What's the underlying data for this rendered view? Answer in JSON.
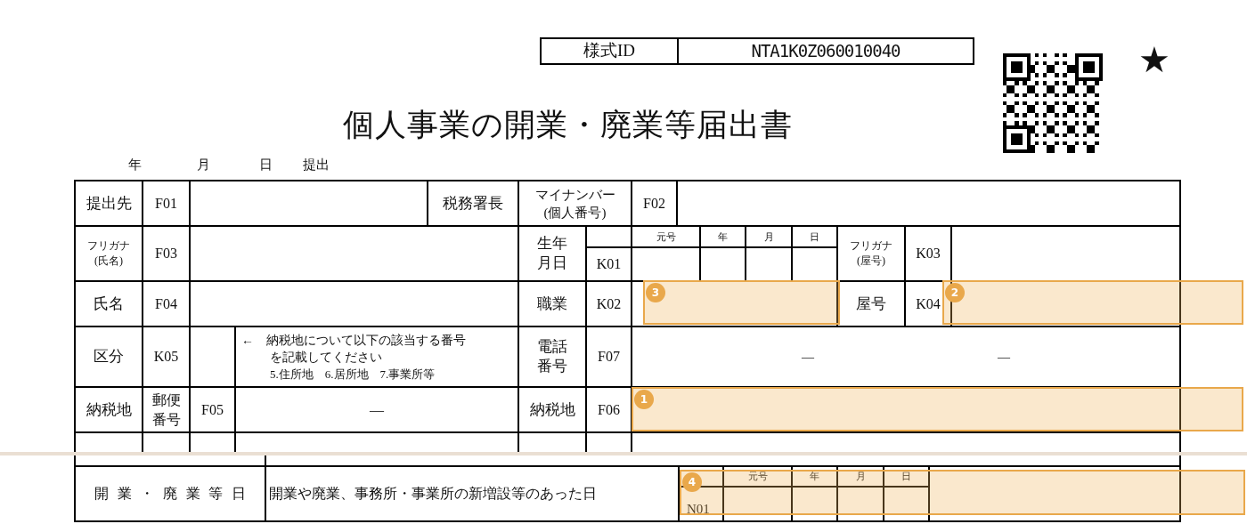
{
  "form_id": {
    "label": "様式ID",
    "value": "NTA1K0Z060010040"
  },
  "star": "★",
  "title": "個人事業の開業・廃業等届出書",
  "submission_date": [
    "年",
    "月",
    "日",
    "提出"
  ],
  "rows": [
    {
      "cells": [
        "提出先",
        "F01",
        "税務署長",
        [
          "マイナンバー",
          "(個人番号)"
        ],
        "F02"
      ]
    },
    {
      "cells": [
        [
          "フリガナ",
          "(氏名)"
        ],
        "F03",
        [
          "生年",
          "月日"
        ],
        "K01",
        {
          "headers": [
            "元号",
            "年",
            "月",
            "日"
          ]
        },
        [
          "フリガナ",
          "(屋号)"
        ],
        "K03"
      ]
    },
    {
      "cells": [
        "氏名",
        "F04",
        "職業",
        "K02",
        "屋号",
        "K04"
      ]
    },
    {
      "cells": [
        "区分",
        "K05",
        {
          "note": "←　納税地について以下の該当する番号を記載してください",
          "options": "5.住所地　6.居所地　7.事業所等"
        },
        [
          "電話",
          "番号"
        ],
        "F07",
        {
          "dashes": [
            "—",
            "—"
          ]
        }
      ]
    },
    {
      "cells": [
        "納税地",
        [
          "郵便",
          "番号"
        ],
        "F05",
        "—",
        "納税地",
        "F06"
      ]
    }
  ],
  "opening_row": {
    "cells": [
      "開業・廃業等日",
      "開業や廃業、事務所・事業所の新増設等のあった日",
      {
        "code": "N01",
        "headers": [
          "元号",
          "年",
          "月",
          "日"
        ]
      }
    ]
  },
  "annotations": [
    {
      "number": "3"
    },
    {
      "number": "2"
    },
    {
      "number": "1"
    },
    {
      "number": "4"
    }
  ]
}
